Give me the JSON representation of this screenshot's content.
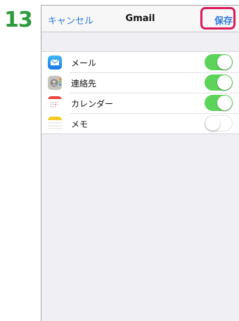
{
  "step_number": "13",
  "nav": {
    "cancel_label": "キャンセル",
    "title": "Gmail",
    "save_label": "保存"
  },
  "rows": [
    {
      "label": "メール",
      "icon": "mail-icon",
      "enabled": true
    },
    {
      "label": "連絡先",
      "icon": "contacts-icon",
      "enabled": true
    },
    {
      "label": "カレンダー",
      "icon": "calendar-icon",
      "enabled": true
    },
    {
      "label": "メモ",
      "icon": "notes-icon",
      "enabled": false
    }
  ],
  "colors": {
    "step_number": "#2d9a3c",
    "link": "#2f7bd9",
    "highlight": "#d81b5a",
    "toggle_on": "#5dd35a"
  }
}
